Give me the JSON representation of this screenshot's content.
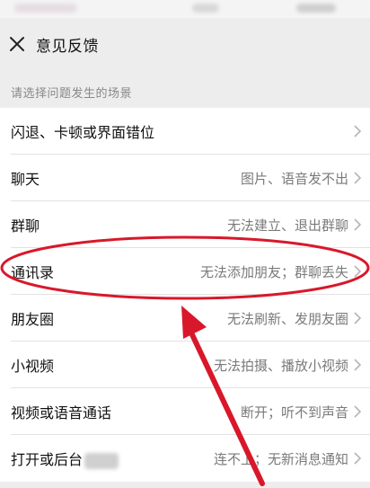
{
  "header": {
    "title": "意见反馈"
  },
  "hint": "请选择问题发生的场景",
  "items": [
    {
      "title": "闪退、卡顿或界面错位",
      "desc": ""
    },
    {
      "title": "聊天",
      "desc": "图片、语音发不出"
    },
    {
      "title": "群聊",
      "desc": "无法建立、退出群聊"
    },
    {
      "title": "通讯录",
      "desc": "无法添加朋友；群聊丢失"
    },
    {
      "title": "朋友圈",
      "desc": "无法刷新、发朋友圈"
    },
    {
      "title": "小视频",
      "desc": "无法拍摄、播放小视频"
    },
    {
      "title": "视频或语音通话",
      "desc": "断开；听不到声音"
    },
    {
      "title": "打开或后台",
      "desc": "连不上；无新消息通知"
    }
  ],
  "colors": {
    "annotation": "#d8182a",
    "background": "#ededed",
    "list_background": "#ffffff",
    "secondary_text": "#7a7a7a"
  },
  "icons": {
    "close": "close-icon",
    "chevron": "chevron-right-icon"
  }
}
